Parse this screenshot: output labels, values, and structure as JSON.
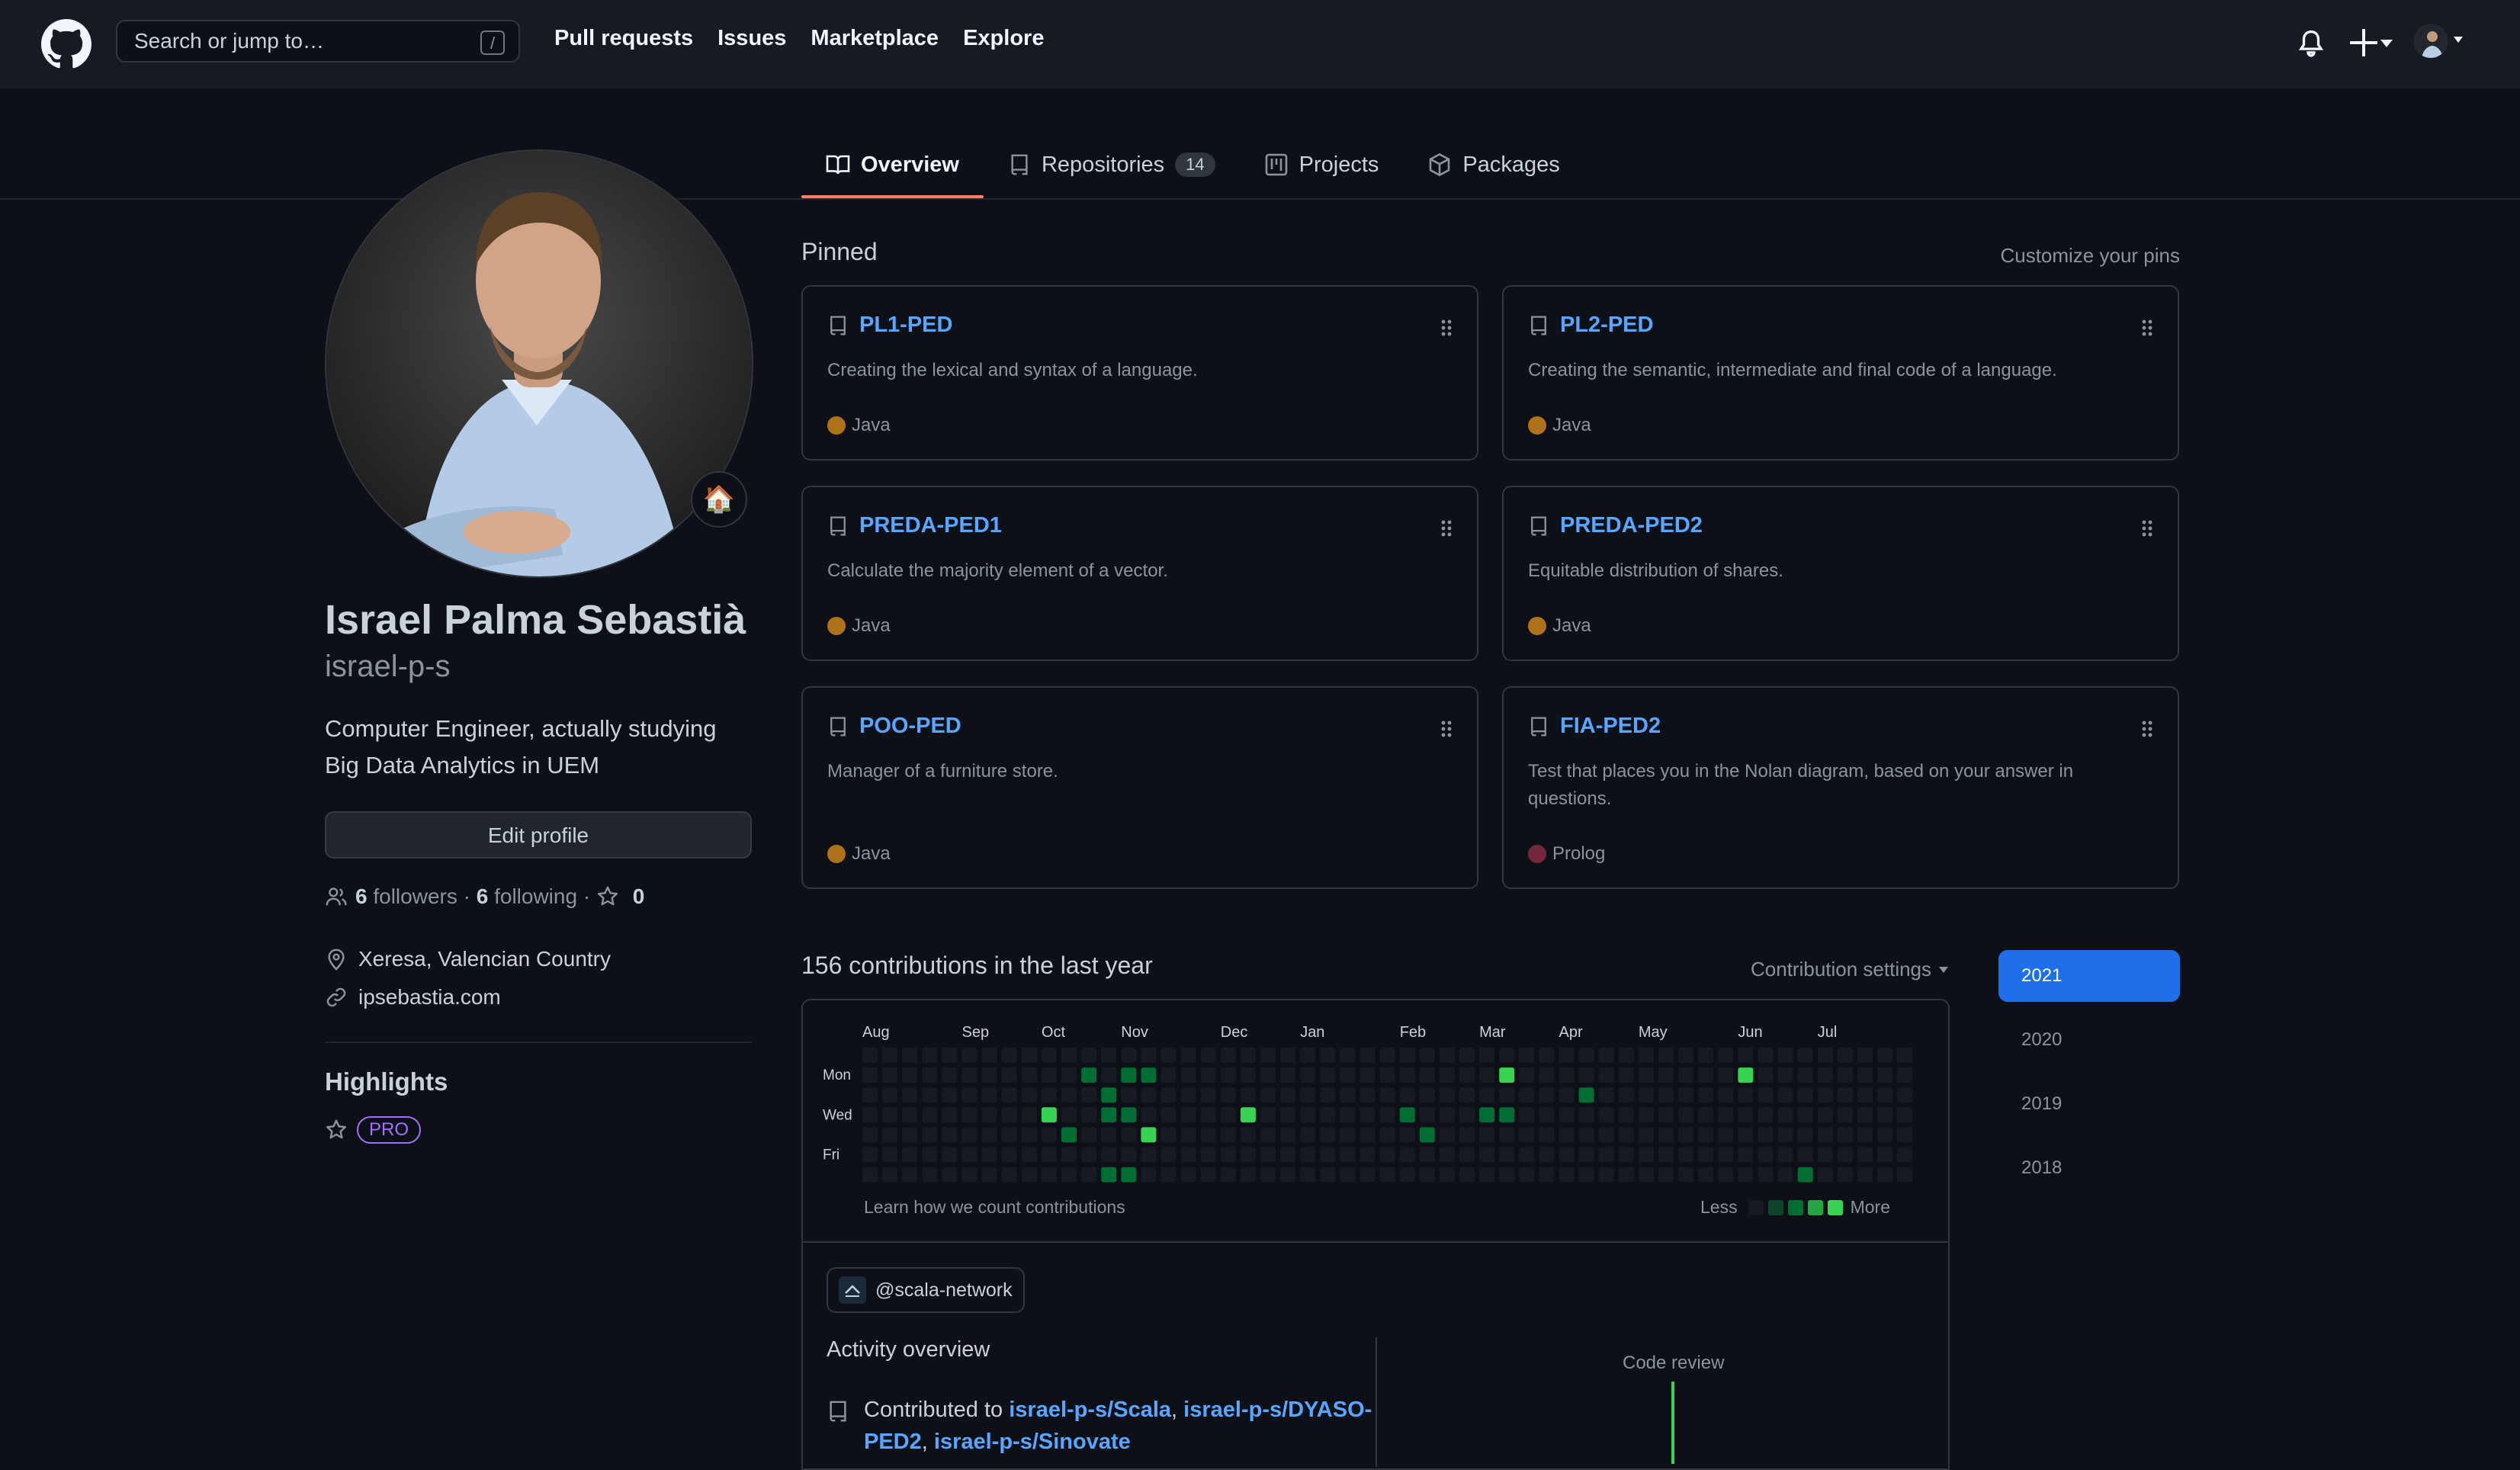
{
  "header": {
    "search_placeholder": "Search or jump to…",
    "search_shortcut": "/",
    "nav": [
      "Pull requests",
      "Issues",
      "Marketplace",
      "Explore"
    ]
  },
  "tabs": [
    {
      "label": "Overview",
      "icon": "book-icon",
      "active": true
    },
    {
      "label": "Repositories",
      "icon": "repo-icon",
      "count": "14"
    },
    {
      "label": "Projects",
      "icon": "project-icon"
    },
    {
      "label": "Packages",
      "icon": "package-icon"
    }
  ],
  "profile": {
    "name": "Israel Palma Sebastià",
    "login": "israel-p-s",
    "status_emoji": "🏠",
    "bio": "Computer Engineer, actually studying Big Data Analytics in UEM",
    "edit_label": "Edit profile",
    "followers_count": "6",
    "followers_label": "followers",
    "following_count": "6",
    "following_label": "following",
    "stars_count": "0",
    "location": "Xeresa, Valencian Country",
    "website": "ipsebastia.com",
    "highlights_title": "Highlights",
    "pro_badge": "PRO"
  },
  "pinned": {
    "title": "Pinned",
    "customize": "Customize your pins",
    "repos": [
      {
        "name": "PL1-PED",
        "desc": "Creating the lexical and syntax of a language.",
        "lang": "Java",
        "lang_color": "#b07219"
      },
      {
        "name": "PL2-PED",
        "desc": "Creating the semantic, intermediate and final code of a language.",
        "lang": "Java",
        "lang_color": "#b07219"
      },
      {
        "name": "PREDA-PED1",
        "desc": "Calculate the majority element of a vector.",
        "lang": "Java",
        "lang_color": "#b07219"
      },
      {
        "name": "PREDA-PED2",
        "desc": "Equitable distribution of shares.",
        "lang": "Java",
        "lang_color": "#b07219"
      },
      {
        "name": "POO-PED",
        "desc": "Manager of a furniture store.",
        "lang": "Java",
        "lang_color": "#b07219"
      },
      {
        "name": "FIA-PED2",
        "desc": "Test that places you in the Nolan diagram, based on your answer in questions.",
        "lang": "Prolog",
        "lang_color": "#74283c"
      }
    ]
  },
  "contributions": {
    "title": "156 contributions in the last year",
    "settings": "Contribution settings",
    "months": [
      "Aug",
      "Sep",
      "Oct",
      "Nov",
      "Dec",
      "Jan",
      "Feb",
      "Mar",
      "Apr",
      "May",
      "Jun",
      "Jul"
    ],
    "days": [
      "Mon",
      "Wed",
      "Fri"
    ],
    "learn": "Learn how we count contributions",
    "less": "Less",
    "more": "More",
    "colors": [
      "#161b22",
      "#0e4429",
      "#006d32",
      "#26a641",
      "#39d353"
    ],
    "active_cells": [
      [
        11,
        1,
        2
      ],
      [
        13,
        1,
        2
      ],
      [
        14,
        1,
        2
      ],
      [
        32,
        1,
        4
      ],
      [
        44,
        1,
        4
      ],
      [
        12,
        2,
        2
      ],
      [
        36,
        2,
        2
      ],
      [
        9,
        3,
        4
      ],
      [
        12,
        3,
        2
      ],
      [
        13,
        3,
        2
      ],
      [
        19,
        3,
        4
      ],
      [
        27,
        3,
        2
      ],
      [
        31,
        3,
        2
      ],
      [
        32,
        3,
        2
      ],
      [
        10,
        4,
        2
      ],
      [
        14,
        4,
        4
      ],
      [
        28,
        4,
        2
      ],
      [
        12,
        6,
        2
      ],
      [
        13,
        6,
        2
      ],
      [
        47,
        6,
        2
      ],
      [
        10,
        7,
        2
      ],
      [
        13,
        7,
        2
      ],
      [
        21,
        7,
        2
      ],
      [
        51,
        7,
        2
      ]
    ],
    "years": [
      "2021",
      "2020",
      "2019",
      "2018"
    ]
  },
  "activity": {
    "org": "@scala-network",
    "title": "Activity overview",
    "contributed_prefix": "Contributed to",
    "repos": [
      "israel-p-s/Scala",
      "israel-p-s/DYASO-PED2",
      "israel-p-s/Sinovate"
    ],
    "code_review": "Code review"
  }
}
